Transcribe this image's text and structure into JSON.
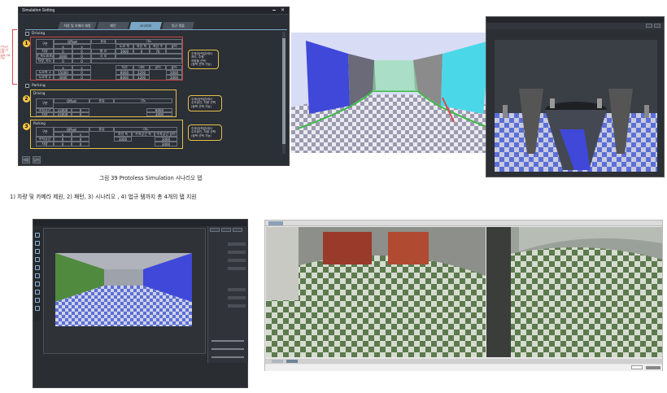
{
  "window": {
    "title": "Simulation Setting",
    "tabs": [
      "차량 및 카메라 제원",
      "패턴",
      "시나리오",
      "법규 템플"
    ],
    "active_tab": 2
  },
  "section1": {
    "marker": "1",
    "checkbox_label": "Driving",
    "columns": [
      "구분",
      "Offset",
      "종류",
      "각도"
    ],
    "subcolumns": [
      "x",
      "y",
      "도로 폭",
      "차선 폭",
      "차선 수",
      "회전 각도",
      "높이"
    ],
    "rows": [
      {
        "label": "차량",
        "x": "0",
        "y": "0",
        "kind": "평 로",
        "v1": "3000",
        "v2": "0",
        "v3": "70"
      },
      {
        "label": "차량_속도(km/h)",
        "x": "3000",
        "y": "0",
        "kind": "곡 로",
        "v1": "",
        "v2": "",
        "v3": ""
      },
      {
        "label": "차량_속도",
        "x": "0",
        "y": "0",
        "kind": "",
        "v1": "",
        "v2": "",
        "v3": ""
      }
    ],
    "sub_header": [
      "x",
      "y",
      "차선",
      "너비",
      "길이",
      "높이"
    ],
    "rows2": [
      {
        "label": "도로폭 1",
        "x": "15000",
        "y": "0",
        "a": "8000",
        "b": "3200",
        "c": "3000"
      },
      {
        "label": "도로폭 2",
        "x": "3000",
        "y": "0",
        "a": "8000",
        "b": "3200",
        "c": "3000"
      }
    ]
  },
  "section2": {
    "marker": "2",
    "checkbox_label": "Parking",
    "sub_label": "Driving",
    "columns": [
      "구분",
      "Offset",
      "종류",
      "각도"
    ],
    "rows": [
      {
        "label": "주차공간",
        "x": "15000",
        "y": "0",
        "v": "8000"
      },
      {
        "label": "차량",
        "x": "15000",
        "y": "0",
        "v": "3000"
      }
    ]
  },
  "section3": {
    "marker": "3",
    "sub_label": "Parking",
    "columns": [
      "구분",
      "Offset",
      "종류",
      "각도"
    ],
    "subcolumns": [
      "x",
      "y",
      "차선 폭",
      "주차공간 폭",
      "주차공간 길이"
    ],
    "rows": [
      {
        "label": "주차공간",
        "x": "0",
        "y": "0",
        "a": "3000",
        "b": "",
        "c": "3000"
      },
      {
        "label": "차량",
        "x": "0",
        "y": "0",
        "a": "",
        "b": "",
        "c": "3000"
      }
    ]
  },
  "notes": {
    "note1": "주제(입력값)에서\n처리, 주행\n차량을 선택\n(중복 선택 가능)",
    "note2": "주제(입력값)에서\n주차공간, 차량 선택\n(중복 선택 가능)",
    "note3": "주제(입력값)에서\n주차공간, 차량 선택\n(중복 선택 가능)",
    "side_note": "주차공간\n기준으로\n선택\n(중복 선택\n가능)"
  },
  "bottom_buttons": [
    "저장",
    "닫기"
  ],
  "caption1": "그림 39 Protoless Simulation 시나리오 탭",
  "caption2": "1) 차량 및 카메라 제원, 2) 패턴, 3) 시나리오 , 4) 법규 템까지 총 4개의 탭 지원",
  "viewer_left_title": "",
  "viewer_right_title": "",
  "colors": {
    "dark_bg": "#2b2f36",
    "accent_yellow": "#e3c24a",
    "tab_active": "#7aa7c7",
    "checker_blue": "#5b6fd6",
    "checker_white": "#e8e8ee"
  }
}
